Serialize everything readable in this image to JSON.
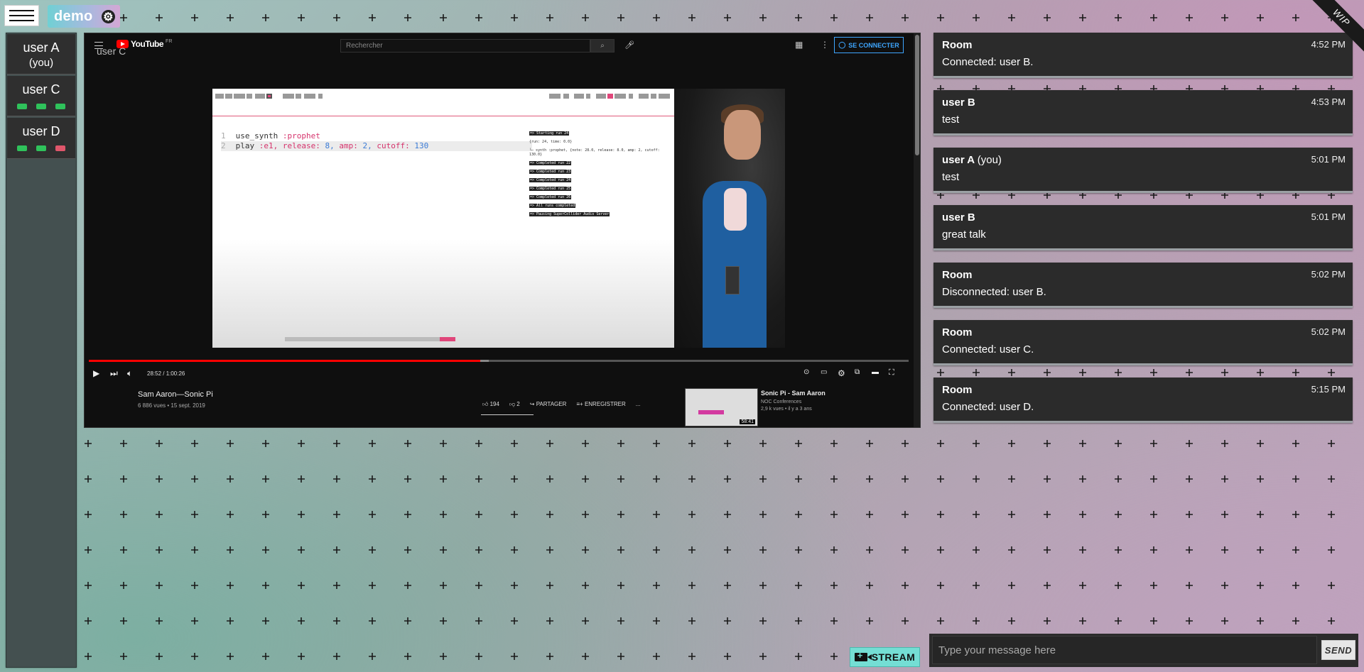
{
  "room": {
    "name": "demo"
  },
  "users": [
    {
      "name": "user A",
      "note": "(you)"
    },
    {
      "name": "user C",
      "status": [
        "#2fc25b",
        "#2fc25b",
        "#2fc25b"
      ]
    },
    {
      "name": "user D",
      "status": [
        "#2fc25b",
        "#2fc25b",
        "#e0566b"
      ]
    }
  ],
  "video": {
    "overlay_user": "user C",
    "youtube": {
      "logo_text": "YouTube",
      "region": "FR",
      "search_placeholder": "Rechercher",
      "signin_label": "SE CONNECTER"
    },
    "code": {
      "line1_num": "1",
      "line1_kw": "use_synth",
      "line1_sym": ":prophet",
      "line2_num": "2",
      "line2_kw": "play",
      "line2_sym": ":e1,",
      "line2_release": "release:",
      "line2_release_val": "8,",
      "line2_amp": "amp:",
      "line2_amp_val": "2,",
      "line2_cutoff": "cutoff:",
      "line2_cutoff_val": "130"
    },
    "log": [
      "=> Starting run 24",
      "{run: 24, time: 0.0}",
      "└─ synth :prophet, {note: 28.0, release: 8.0, amp: 2, cutoff: 130.0}",
      "=> Completed run 22",
      "=> Completed run 23",
      "=> Completed run 24",
      "=> Completed run 25",
      "=> Completed run 26",
      "=> All runs completed",
      "=> Pausing SuperCollider Audio Server"
    ],
    "time_display": "28:52 / 1:00:26",
    "progress_played": 0.4775,
    "progress_loaded": 0.488,
    "title": "Sam Aaron—Sonic Pi",
    "meta": "6 886 vues • 15 sept. 2019",
    "likes": "194",
    "dislikes": "2",
    "share_label": "PARTAGER",
    "save_label": "ENREGISTRER",
    "more_label": "...",
    "recommended": {
      "title": "Sonic Pi - Sam Aaron",
      "channel": "NOC Conferences",
      "meta": "2,9 k vues • il y a 3 ans",
      "duration": "58:41"
    }
  },
  "chat": {
    "messages": [
      {
        "author": "Room",
        "you": "",
        "time": "4:52 PM",
        "text": "Connected: user B."
      },
      {
        "author": "user B",
        "you": "",
        "time": "4:53 PM",
        "text": "test"
      },
      {
        "author": "user A",
        "you": "(you)",
        "time": "5:01 PM",
        "text": "test"
      },
      {
        "author": "user B",
        "you": "",
        "time": "5:01 PM",
        "text": "great talk"
      },
      {
        "author": "Room",
        "you": "",
        "time": "5:02 PM",
        "text": "Disconnected: user B."
      },
      {
        "author": "Room",
        "you": "",
        "time": "5:02 PM",
        "text": "Connected: user C."
      },
      {
        "author": "Room",
        "you": "",
        "time": "5:15 PM",
        "text": "Connected: user D."
      }
    ],
    "input_placeholder": "Type your message here",
    "send_label": "SEND"
  },
  "stream_label": "STREAM",
  "ribbon": "WIP",
  "icons": {
    "menu": "hamburger-icon",
    "settings": "gear-icon",
    "stream": "video-camera-plus-icon"
  }
}
